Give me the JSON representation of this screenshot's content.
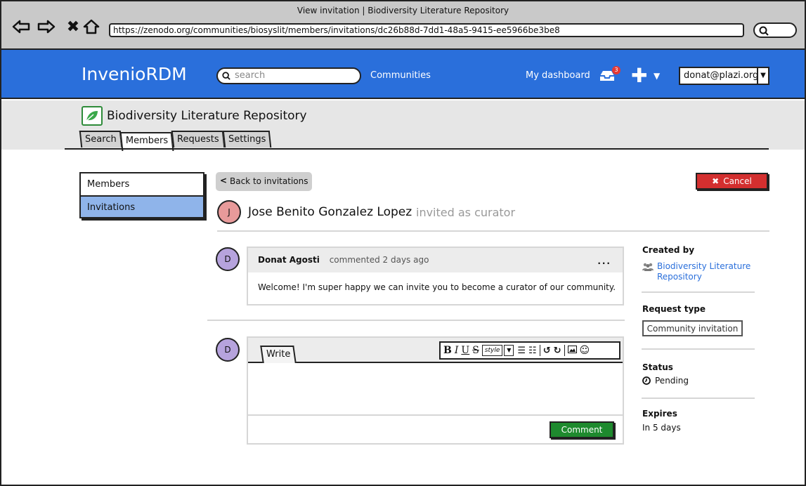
{
  "window": {
    "title": "View invitation | Biodiversity Literature Repository",
    "url": "https://zenodo.org/communities/biosyslit/members/invitations/dc26b88d-7dd1-48a5-9415-ee5966be3be8"
  },
  "appbar": {
    "brand": "InvenioRDM",
    "search_placeholder": "search",
    "communities_link": "Communities",
    "dashboard_link": "My dashboard",
    "inbox_count": "3",
    "user": "donat@plazi.org"
  },
  "community": {
    "title": "Biodiversity Literature Repository",
    "tabs": [
      {
        "label": "Search",
        "active": false
      },
      {
        "label": "Members",
        "active": true
      },
      {
        "label": "Requests",
        "active": false
      },
      {
        "label": "Settings",
        "active": false
      }
    ]
  },
  "menu": {
    "items": [
      {
        "label": "Members",
        "active": false
      },
      {
        "label": "Invitations",
        "active": true
      }
    ]
  },
  "request": {
    "back_label": "Back to invitations",
    "cancel_label": "Cancel",
    "invitee_initial": "J",
    "invitee_name": "Jose Benito Gonzalez Lopez",
    "invitee_role": "invited as curator"
  },
  "comment": {
    "initial": "D",
    "author": "Donat Agosti",
    "meta": "commented 2 days ago",
    "menu": "...",
    "body": "Welcome! I'm super happy we can invite you to become a curator of our community."
  },
  "editor": {
    "initial": "D",
    "tab_label": "Write",
    "style_label": "style",
    "submit_label": "Comment"
  },
  "sidebar": {
    "created_by_label": "Created by",
    "created_by_value": "Biodiversity Literature Repository",
    "request_type_label": "Request type",
    "request_type_value": "Community invitation",
    "status_label": "Status",
    "status_value": "Pending",
    "expires_label": "Expires",
    "expires_value": "In 5 days"
  },
  "colors": {
    "brand_blue": "#2a6fdb",
    "cancel_red": "#d32f2f",
    "comment_green": "#1e8a2e",
    "active_menu": "#8fb4ea"
  }
}
